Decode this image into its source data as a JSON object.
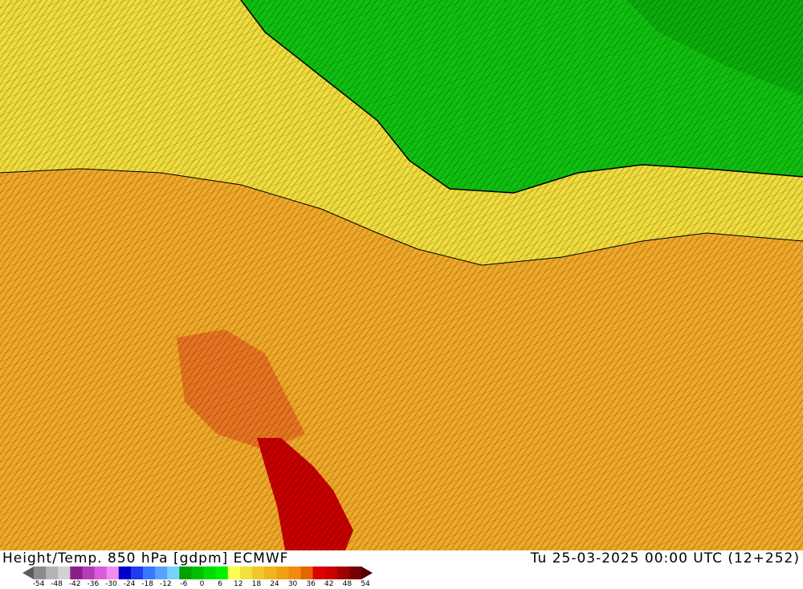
{
  "map": {
    "regions": [
      {
        "name": "cold-region",
        "color": "#18c818"
      },
      {
        "name": "cool-region",
        "color": "#f0e040"
      },
      {
        "name": "warm-region",
        "color": "#f0a020"
      },
      {
        "name": "hot-region",
        "color": "#e86818"
      },
      {
        "name": "very-hot-region",
        "color": "#c80000"
      }
    ]
  },
  "footer": {
    "title": "Height/Temp. 850 hPa [gdpm] ECMWF",
    "datetime": "Tu 25-03-2025 00:00 UTC (12+252)"
  },
  "legend": {
    "ticks": [
      "-54",
      "-48",
      "-42",
      "-36",
      "-30",
      "-24",
      "-18",
      "-12",
      "-6",
      "0",
      "6",
      "12",
      "18",
      "24",
      "30",
      "36",
      "42",
      "48",
      "54"
    ],
    "colors": [
      "#5a5a5a",
      "#8c8c8c",
      "#b4b4b4",
      "#d2d2d2",
      "#8c1e8c",
      "#b43cb4",
      "#dc5adc",
      "#f08cf0",
      "#0000c8",
      "#1e3cf0",
      "#3c78ff",
      "#5aa0ff",
      "#78d2ff",
      "#00a000",
      "#00be00",
      "#00dc00",
      "#00f000",
      "#ffff50",
      "#f0e040",
      "#f0c828",
      "#f0b41e",
      "#f0a014",
      "#f08c0a",
      "#e66400",
      "#dc0000",
      "#c80000",
      "#a00000",
      "#780000",
      "#500000"
    ]
  }
}
